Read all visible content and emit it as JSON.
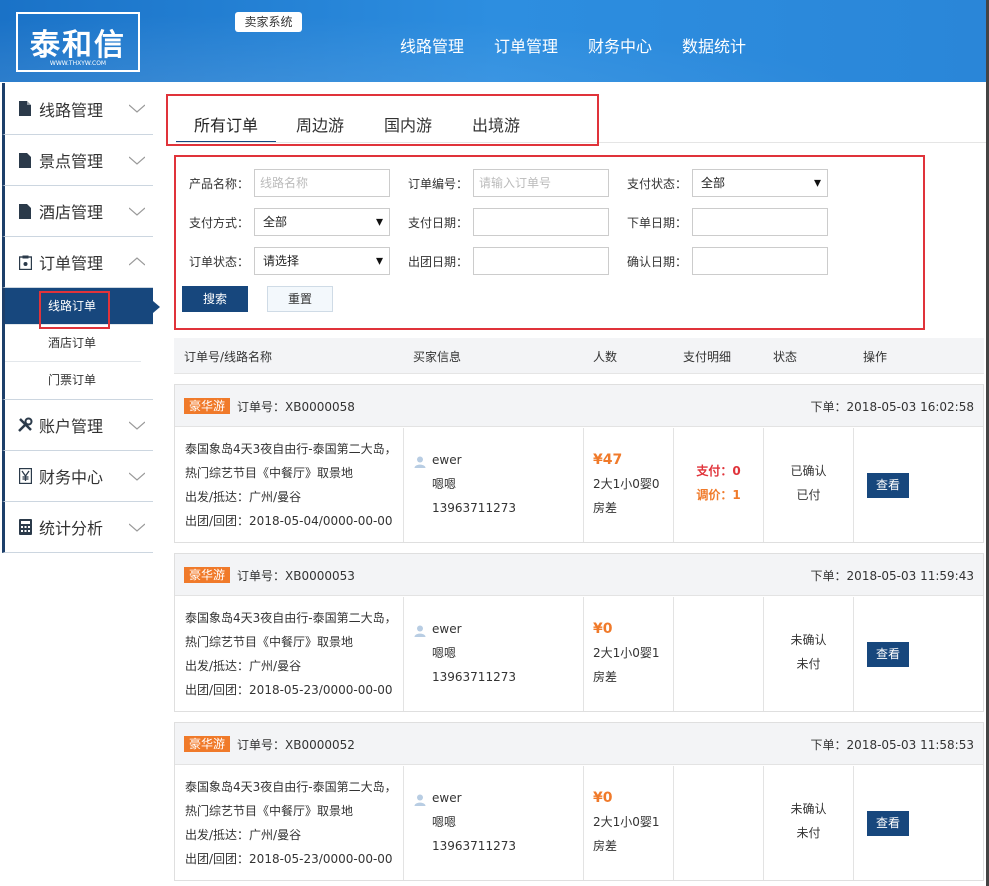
{
  "header": {
    "logo_text": "泰和信",
    "logo_sub": "WWW.THXYW.COM",
    "system_badge": "卖家系统",
    "nav": [
      "线路管理",
      "订单管理",
      "财务中心",
      "数据统计"
    ]
  },
  "sidebar": {
    "items": [
      {
        "label": "线路管理",
        "icon": "document-icon"
      },
      {
        "label": "景点管理",
        "icon": "document-icon"
      },
      {
        "label": "酒店管理",
        "icon": "document-icon"
      },
      {
        "label": "订单管理",
        "icon": "clipboard-icon",
        "expanded": true
      },
      {
        "label": "账户管理",
        "icon": "tools-icon"
      },
      {
        "label": "财务中心",
        "icon": "yen-icon"
      },
      {
        "label": "统计分析",
        "icon": "calculator-icon"
      }
    ],
    "sub_items": [
      "线路订单",
      "酒店订单",
      "门票订单"
    ],
    "active_sub": "线路订单"
  },
  "tabs": [
    "所有订单",
    "周边游",
    "国内游",
    "出境游"
  ],
  "filter": {
    "product_name_label": "产品名称：",
    "product_name_placeholder": "线路名称",
    "order_no_label": "订单编号：",
    "order_no_placeholder": "请输入订单号",
    "pay_status_label": "支付状态：",
    "pay_status_value": "全部",
    "pay_method_label": "支付方式：",
    "pay_method_value": "全部",
    "pay_date_label": "支付日期：",
    "order_date_label": "下单日期：",
    "order_status_label": "订单状态：",
    "order_status_value": "请选择",
    "depart_date_label": "出团日期：",
    "confirm_date_label": "确认日期：",
    "search_label": "搜索",
    "reset_label": "重置"
  },
  "table_headers": [
    "订单号/线路名称",
    "买家信息",
    "人数",
    "支付明细",
    "状态",
    "操作"
  ],
  "orders": [
    {
      "tag": "豪华游",
      "order_no": "订单号：XB0000058",
      "order_time": "下单：2018-05-03 16:02:58",
      "route_line1": "泰国象岛4天3夜自由行-泰国第二大岛，",
      "route_line2": "热门综艺节目《中餐厅》取景地",
      "route_line3": "出发/抵达：广州/曼谷",
      "route_line4": "出团/回团：2018-05-04/0000-00-00",
      "buyer_name": "ewer",
      "buyer_nick": "嗯嗯",
      "buyer_phone": "13963711273",
      "price": "¥47",
      "people": "2大1小0婴0",
      "room_diff": "房差",
      "pay": "支付：0",
      "adjust": "调价：1",
      "confirm_status": "已确认",
      "pay_status": "已付",
      "view_label": "查看"
    },
    {
      "tag": "豪华游",
      "order_no": "订单号：XB0000053",
      "order_time": "下单：2018-05-03 11:59:43",
      "route_line1": "泰国象岛4天3夜自由行-泰国第二大岛，",
      "route_line2": "热门综艺节目《中餐厅》取景地",
      "route_line3": "出发/抵达：广州/曼谷",
      "route_line4": "出团/回团：2018-05-23/0000-00-00",
      "buyer_name": "ewer",
      "buyer_nick": "嗯嗯",
      "buyer_phone": "13963711273",
      "price": "¥0",
      "people": "2大1小0婴1",
      "room_diff": "房差",
      "pay": "",
      "adjust": "",
      "confirm_status": "未确认",
      "pay_status": "未付",
      "view_label": "查看"
    },
    {
      "tag": "豪华游",
      "order_no": "订单号：XB0000052",
      "order_time": "下单：2018-05-03 11:58:53",
      "route_line1": "泰国象岛4天3夜自由行-泰国第二大岛，",
      "route_line2": "热门综艺节目《中餐厅》取景地",
      "route_line3": "出发/抵达：广州/曼谷",
      "route_line4": "出团/回团：2018-05-23/0000-00-00",
      "buyer_name": "ewer",
      "buyer_nick": "嗯嗯",
      "buyer_phone": "13963711273",
      "price": "¥0",
      "people": "2大1小0婴1",
      "room_diff": "房差",
      "pay": "",
      "adjust": "",
      "confirm_status": "未确认",
      "pay_status": "未付",
      "view_label": "查看"
    }
  ],
  "colors": {
    "header_blue": "#2a86d8",
    "navy": "#17477d",
    "orange": "#f07a2a",
    "red": "#e0333a"
  }
}
